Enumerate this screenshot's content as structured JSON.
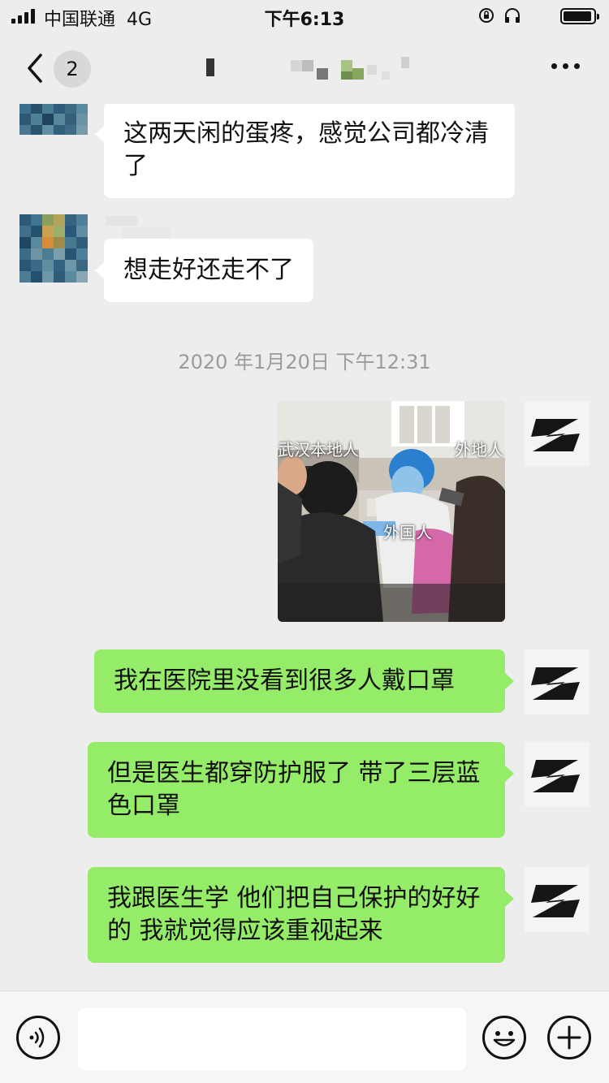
{
  "status_bar": {
    "carrier": "中国联通",
    "network": "4G",
    "time": "下午6:13"
  },
  "nav": {
    "unread_count": "2"
  },
  "messages": [
    {
      "side": "left",
      "type": "text",
      "text": "这两天闲的蛋疼，感觉公司都冷清了"
    },
    {
      "side": "left",
      "type": "text",
      "text": "想走好还走不了"
    },
    {
      "type": "timestamp",
      "text": "2020 年1月20日 下午12:31"
    },
    {
      "side": "right",
      "type": "image",
      "labels": [
        "武汉本地人",
        "外地人",
        "外国人"
      ]
    },
    {
      "side": "right",
      "type": "text",
      "text": "我在医院里没看到很多人戴口罩"
    },
    {
      "side": "right",
      "type": "text",
      "text": "但是医生都穿防护服了 带了三层蓝色口罩"
    },
    {
      "side": "right",
      "type": "text",
      "text": "我跟医生学 他们把自己保护的好好的 我就觉得应该重视起来"
    }
  ],
  "input": {
    "value": ""
  },
  "colors": {
    "background": "#ededed",
    "sent_bubble": "#95ec69",
    "received_bubble": "#ffffff",
    "timestamp_text": "#9b9b9b"
  },
  "icons": [
    "back-chevron-icon",
    "more-icon",
    "voice-icon",
    "emoji-icon",
    "plus-icon"
  ]
}
